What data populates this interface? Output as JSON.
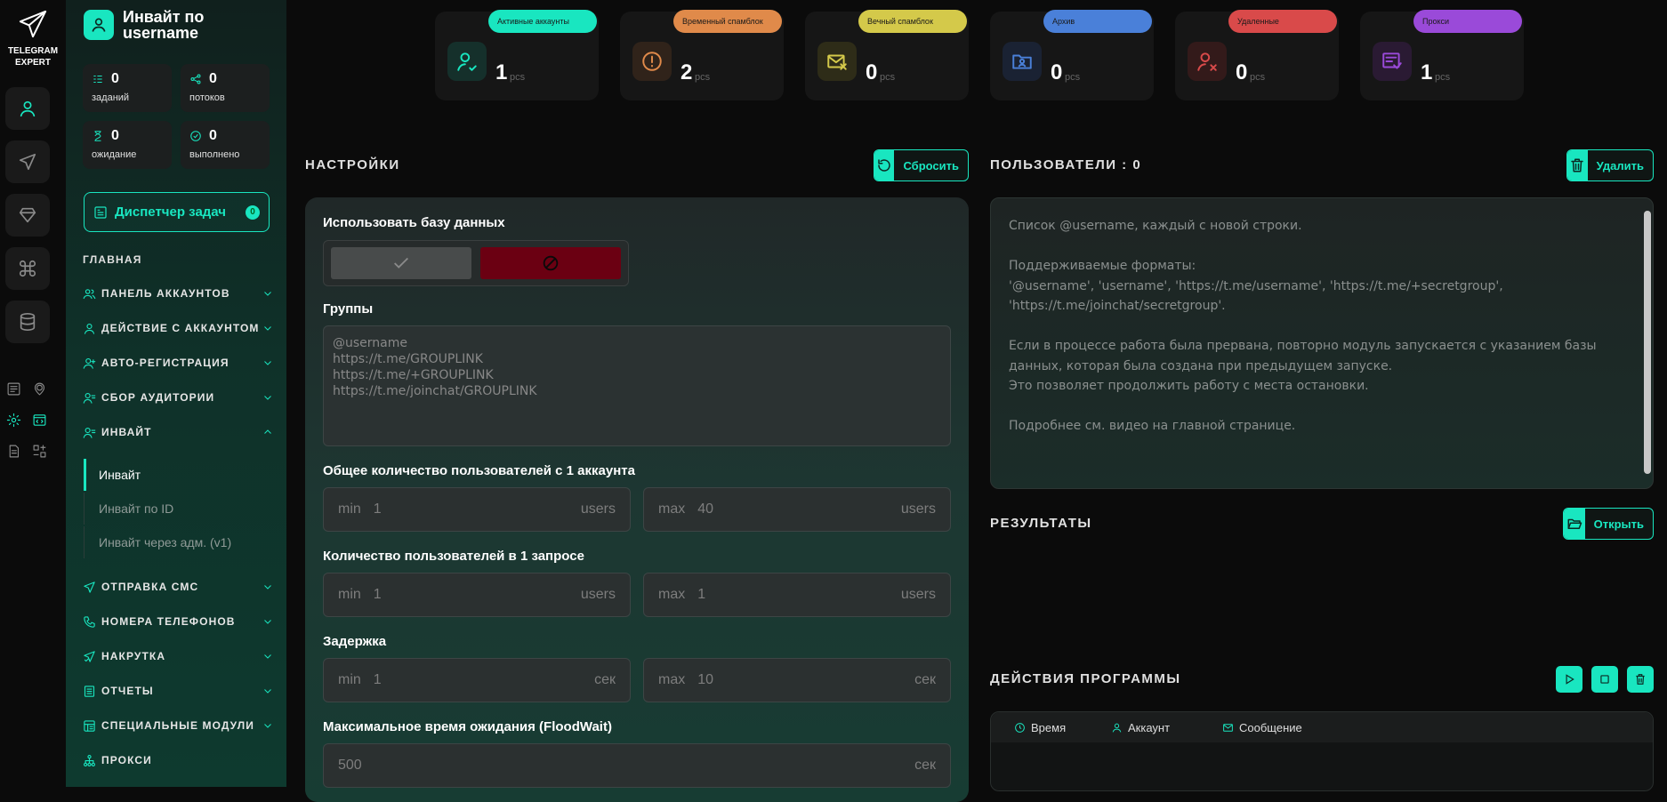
{
  "app": {
    "logo_line1": "TELEGRAM",
    "logo_line2": "EXPERT"
  },
  "sidebar": {
    "title": "Инвайт по username",
    "stats": [
      {
        "value": "0",
        "label": "заданий"
      },
      {
        "value": "0",
        "label": "потоков"
      },
      {
        "value": "0",
        "label": "ожидание"
      },
      {
        "value": "0",
        "label": "выполнено"
      }
    ],
    "dispatcher": {
      "label": "Диспетчер задач",
      "badge": "0"
    },
    "section": "ГЛАВНАЯ",
    "nav": [
      {
        "label": "ПАНЕЛЬ АККАУНТОВ"
      },
      {
        "label": "ДЕЙСТВИЕ С АККАУНТОМ"
      },
      {
        "label": "АВТО-РЕГИСТРАЦИЯ"
      },
      {
        "label": "СБОР АУДИТОРИИ"
      },
      {
        "label": "ИНВАЙТ"
      },
      {
        "label": "ОТПРАВКА СМС"
      },
      {
        "label": "НОМЕРА ТЕЛЕФОНОВ"
      },
      {
        "label": "НАКРУТКА"
      },
      {
        "label": "ОТЧЕТЫ"
      },
      {
        "label": "СПЕЦИАЛЬНЫЕ МОДУЛИ"
      },
      {
        "label": "ПРОКСИ"
      }
    ],
    "subnav": [
      {
        "label": "Инвайт"
      },
      {
        "label": "Инвайт по ID"
      },
      {
        "label": "Инвайт через адм. (v1)"
      }
    ]
  },
  "cards": [
    {
      "tag": "Активные аккаунты",
      "value": "1",
      "unit": "pcs",
      "color": "#19e6c0"
    },
    {
      "tag": "Временный спамблок",
      "value": "2",
      "unit": "pcs",
      "color": "#e08a4a"
    },
    {
      "tag": "Вечный спамблок",
      "value": "0",
      "unit": "pcs",
      "color": "#d4c94a"
    },
    {
      "tag": "Архив",
      "value": "0",
      "unit": "pcs",
      "color": "#4a80d9"
    },
    {
      "tag": "Удаленные",
      "value": "0",
      "unit": "pcs",
      "color": "#d94a4a"
    },
    {
      "tag": "Прокси",
      "value": "1",
      "unit": "pcs",
      "color": "#9a4ad9"
    }
  ],
  "settings": {
    "title": "НАСТРОЙКИ",
    "reset_label": "Сбросить",
    "use_db_label": "Использовать базу данных",
    "groups_label": "Группы",
    "groups_placeholder": "@username\nhttps://t.me/GROUPLINK\nhttps://t.me/+GROUPLINK\nhttps://t.me/joinchat/GROUPLINK",
    "total_users_label": "Общее количество пользователей с 1 аккаунта",
    "per_request_label": "Количество пользователей в 1 запросе",
    "delay_label": "Задержка",
    "floodwait_label": "Максимальное время ожидания (FloodWait)",
    "min_label": "min",
    "max_label": "max",
    "users_unit": "users",
    "sec_unit": "сек",
    "total_min": "1",
    "total_max": "40",
    "req_min": "1",
    "req_max": "1",
    "delay_min": "1",
    "delay_max": "10",
    "floodwait": "500"
  },
  "users": {
    "title": "ПОЛЬЗОВАТЕЛИ : 0",
    "delete_label": "Удалить",
    "placeholder_lines": [
      "Список @username, каждый с новой строки.",
      "",
      "Поддерживаемые форматы:",
      "'@username', 'username', 'https://t.me/username', 'https://t.me/+secretgroup', 'https://t.me/joinchat/secretgroup'.",
      "",
      "Если в процессе работа была прервана, повторно модуль запускается с указанием базы данных, которая была создана при предыдущем запуске.",
      "Это позволяет продолжить работу с места остановки.",
      "",
      "Подробнее см. видео на главной странице."
    ]
  },
  "results": {
    "title": "РЕЗУЛЬТАТЫ",
    "open_label": "Открыть"
  },
  "actions": {
    "title": "ДЕЙСТВИЯ ПРОГРАММЫ",
    "col_time": "Время",
    "col_account": "Аккаунт",
    "col_message": "Сообщение"
  },
  "accent": "#19e6c0"
}
